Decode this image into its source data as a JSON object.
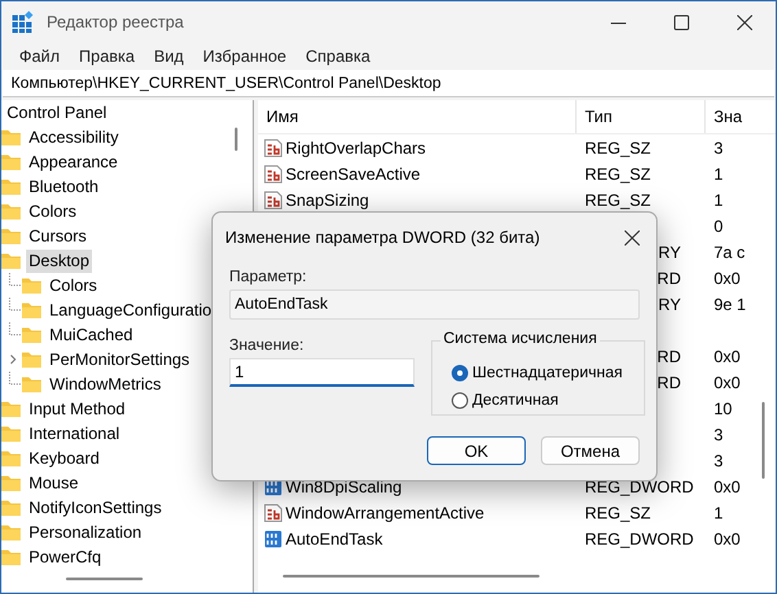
{
  "window": {
    "title": "Редактор реестра"
  },
  "menu": [
    "Файл",
    "Правка",
    "Вид",
    "Избранное",
    "Справка"
  ],
  "address": "Компьютер\\HKEY_CURRENT_USER\\Control Panel\\Desktop",
  "tree": [
    {
      "label": "Control Panel",
      "selected": false,
      "children": [
        {
          "label": "Accessibility",
          "selected": false
        },
        {
          "label": "Appearance",
          "selected": false
        },
        {
          "label": "Bluetooth",
          "selected": false
        },
        {
          "label": "Colors",
          "selected": false
        },
        {
          "label": "Cursors",
          "selected": false
        },
        {
          "label": "Desktop",
          "selected": true,
          "children": [
            {
              "label": "Colors",
              "selected": false
            },
            {
              "label": "LanguageConfiguratio",
              "selected": false
            },
            {
              "label": "MuiCached",
              "selected": false
            },
            {
              "label": "PerMonitorSettings",
              "selected": false,
              "expanded": false
            },
            {
              "label": "WindowMetrics",
              "selected": false
            }
          ]
        },
        {
          "label": "Input Method",
          "selected": false
        },
        {
          "label": "International",
          "selected": false
        },
        {
          "label": "Keyboard",
          "selected": false
        },
        {
          "label": "Mouse",
          "selected": false
        },
        {
          "label": "NotifyIconSettings",
          "selected": false
        },
        {
          "label": "Personalization",
          "selected": false
        },
        {
          "label": "PowerCfq",
          "selected": false
        }
      ]
    }
  ],
  "list": {
    "columns": [
      "Имя",
      "Тип",
      "Зна"
    ],
    "rows": [
      {
        "kind": "string",
        "name": "RightOverlapChars",
        "type": "REG_SZ",
        "value": "3"
      },
      {
        "kind": "string",
        "name": "ScreenSaveActive",
        "type": "REG_SZ",
        "value": "1"
      },
      {
        "kind": "string",
        "name": "SnapSizing",
        "type": "REG_SZ",
        "value": "1"
      },
      {
        "kind": "covered",
        "value": "0"
      },
      {
        "kind": "covered",
        "type": "RY",
        "value": "7a c"
      },
      {
        "kind": "covered",
        "type": "RD",
        "value": "0x0"
      },
      {
        "kind": "covered",
        "type": "RY",
        "value": "9e 1"
      },
      {
        "kind": "covered"
      },
      {
        "kind": "covered",
        "type": "RD",
        "value": "0x0"
      },
      {
        "kind": "covered",
        "type": "RD",
        "value": "0x0"
      },
      {
        "kind": "covered",
        "value": "10"
      },
      {
        "kind": "covered",
        "value": "3"
      },
      {
        "kind": "covered",
        "value": "3"
      },
      {
        "kind": "dword",
        "name": "Win8DpiScaling",
        "type": "REG_DWORD",
        "value": "0x0"
      },
      {
        "kind": "string",
        "name": "WindowArrangementActive",
        "type": "REG_SZ",
        "value": "1"
      },
      {
        "kind": "dword",
        "name": "AutoEndTask",
        "type": "REG_DWORD",
        "value": "0x0"
      }
    ]
  },
  "dialog": {
    "title": "Изменение параметра DWORD (32 бита)",
    "name_label": "Параметр:",
    "name_value": "AutoEndTask",
    "value_label": "Значение:",
    "value": "1",
    "base_group": "Система исчисления",
    "bases": [
      {
        "label": "Шестнадцатеричная",
        "selected": true
      },
      {
        "label": "Десятичная",
        "selected": false
      }
    ],
    "buttons": [
      {
        "label": "OK",
        "default": true
      },
      {
        "label": "Отмена",
        "default": false
      }
    ]
  }
}
